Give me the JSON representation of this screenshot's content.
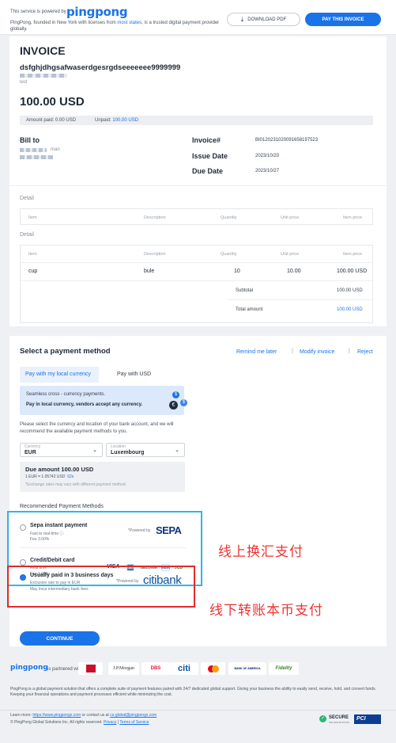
{
  "header": {
    "powered_text": "This service is powered by",
    "logo": "pingpong",
    "desc_a": "PingPong, founded in New York with licenses from ",
    "desc_link": "most states",
    "desc_b": ", is a trusted digital payment provider",
    "desc_c": "globally.",
    "download_label": "DOWNLOAD PDF",
    "pay_label": "PAY THIS INVOICE"
  },
  "invoice": {
    "title": "INVOICE",
    "merchant": "dsfghjdhgsafwaserdgesrgdseeeeeee9999999",
    "merchant_sub": "test",
    "amount": "100.00 USD",
    "amount_paid_label": "Amount paid:",
    "amount_paid": "0.00 USD",
    "unpaid_label": "Unpaid:",
    "unpaid": "100.00 USD",
    "bill_to_label": "Bill to",
    "bill_to_name": "man",
    "invoice_no_label": "Invoice#",
    "invoice_no": "BI0120231020091658197523",
    "issue_label": "Issue Date",
    "issue_date": "2023/10/20",
    "due_label": "Due Date",
    "due_date": "2023/10/27",
    "detail_label": "Detail",
    "columns": [
      "Item",
      "Description",
      "Quantity",
      "Unit price",
      "Item price"
    ],
    "rows": [
      {
        "item": "cup",
        "description": "bule",
        "quantity": "10",
        "unit_price": "10.00",
        "item_price": "100.00 USD"
      }
    ],
    "subtotal_label": "Subtotal",
    "subtotal": "100.00 USD",
    "total_label": "Total amount",
    "total": "100.00 USD"
  },
  "payment": {
    "title": "Select a payment method",
    "remind_label": "Remind me later",
    "modify_label": "Modify invoice",
    "reject_label": "Reject",
    "tab_local": "Pay with my local currency",
    "tab_usd": "Pay with USD",
    "banner_line1": "Seamless cross - currency payments.",
    "banner_line2": "Pay in local currency, vendors accept any currency.",
    "select_hint": "Please select the currency and location of your bank account, and we will recommend the available payment methods to you.",
    "currency_label": "Currency",
    "currency_value": "EUR",
    "location_label": "Location",
    "location_value": "Luxembourg",
    "due_amount": "Due amount 100.00 USD",
    "rate_text": "1 EUR = 1.05742 USD",
    "rate_timer": "62s",
    "rate_note": "*Exchange rates may vary with different payment method.",
    "recommended_label": "Recommended Payment Methods",
    "methods": [
      {
        "name": "Sepa instant payment",
        "line1": "Fast to real-time ⓘ",
        "line2": "Fee 3.00%",
        "powered": "*Powered by",
        "brand": "SEPA"
      },
      {
        "name": "Credit/Debit card",
        "line1": "Real time",
        "line2": "Fee 3.00%"
      },
      {
        "name": "Usually paid in 3 business days",
        "line1": "Exclusive rate to pay in EUR",
        "line2": "May incur intermediary bank fees",
        "powered": "*Powered by",
        "brand": "citibank"
      }
    ],
    "card_brands": [
      "VISA",
      "AMEX",
      "DISCOVER",
      "DINERS",
      "JCB"
    ],
    "continue_label": "CONTINUE",
    "note_online": "线上换汇支付",
    "note_offline": "线下转账本币支付"
  },
  "partners": {
    "logo": "pingpong",
    "label": "is partnered with",
    "names": [
      "BOC",
      "J.P.Morgan",
      "DBS",
      "citi",
      "mastercard",
      "BANK OF AMERICA",
      "Fidelity"
    ]
  },
  "footer": {
    "about": "PingPong is a global payment solution that offers a complete suite of payment features paired with 24/7 dedicated global support. Giving your business the ability to easily send, receive, hold, and convert funds. Keeping your financial operations and payment processes efficient while minimizing the cost.",
    "learn_a": "Learn more: ",
    "learn_link": "https://www.pingpongx.com",
    "learn_b": " or contact us at ",
    "contact": "cs-global@pingpongx.com",
    "copyright": "© PingPong Global Solutions Inc. All rights reserved. ",
    "privacy": "Privacy",
    "terms": "Terms of Service",
    "secure_label": "SECURE",
    "secure_sub": "SSL ENCRYPTION",
    "pci_label": "PCI"
  },
  "colors": {
    "brand": "#1a73e8",
    "cyan_highlight": "#31b6e6",
    "red_highlight": "#e12b2b",
    "annotation": "#e33333"
  }
}
